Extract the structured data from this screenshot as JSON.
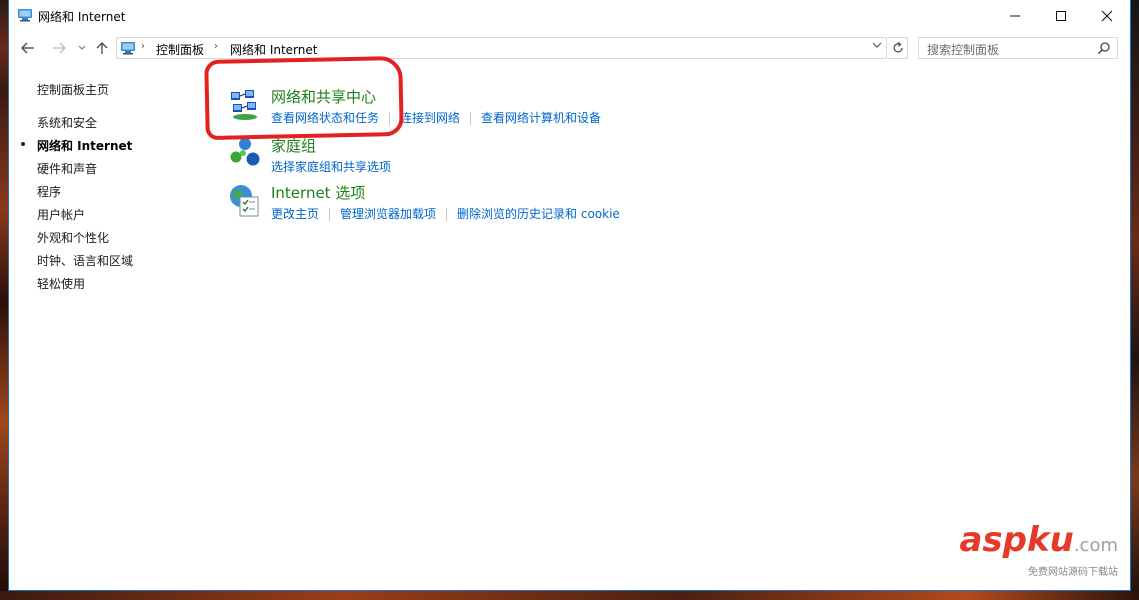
{
  "window": {
    "title": "网络和 Internet",
    "controls": {
      "minimize": "—",
      "maximize": "☐",
      "close": "✕"
    }
  },
  "nav": {
    "back": "←",
    "forward": "→",
    "recent": "∨",
    "up": "↑",
    "breadcrumbs": [
      "控制面板",
      "网络和 Internet"
    ],
    "separator": "›",
    "dropdown": "∨",
    "refresh": "↻",
    "search_placeholder": "搜索控制面板"
  },
  "sidebar": {
    "home": "控制面板主页",
    "items": [
      "系统和安全",
      "网络和 Internet",
      "硬件和声音",
      "程序",
      "用户帐户",
      "外观和个性化",
      "时钟、语言和区域",
      "轻松使用"
    ],
    "active_index": 1
  },
  "categories": [
    {
      "title": "网络和共享中心",
      "icon": "network-sharing-icon",
      "links": [
        "查看网络状态和任务",
        "连接到网络",
        "查看网络计算机和设备"
      ]
    },
    {
      "title": "家庭组",
      "icon": "homegroup-icon",
      "links": [
        "选择家庭组和共享选项"
      ]
    },
    {
      "title": "Internet 选项",
      "icon": "internet-options-icon",
      "links": [
        "更改主页",
        "管理浏览器加载项",
        "删除浏览的历史记录和 cookie"
      ]
    }
  ],
  "watermark": {
    "brand_a": "asp",
    "brand_b": "ku",
    "domain": ".com",
    "tagline": "免费网站源码下载站"
  },
  "colors": {
    "title_green": "#1e7f1e",
    "link_blue": "#0066cc",
    "highlight_red": "#e52020",
    "window_border": "#1c6fc4"
  }
}
